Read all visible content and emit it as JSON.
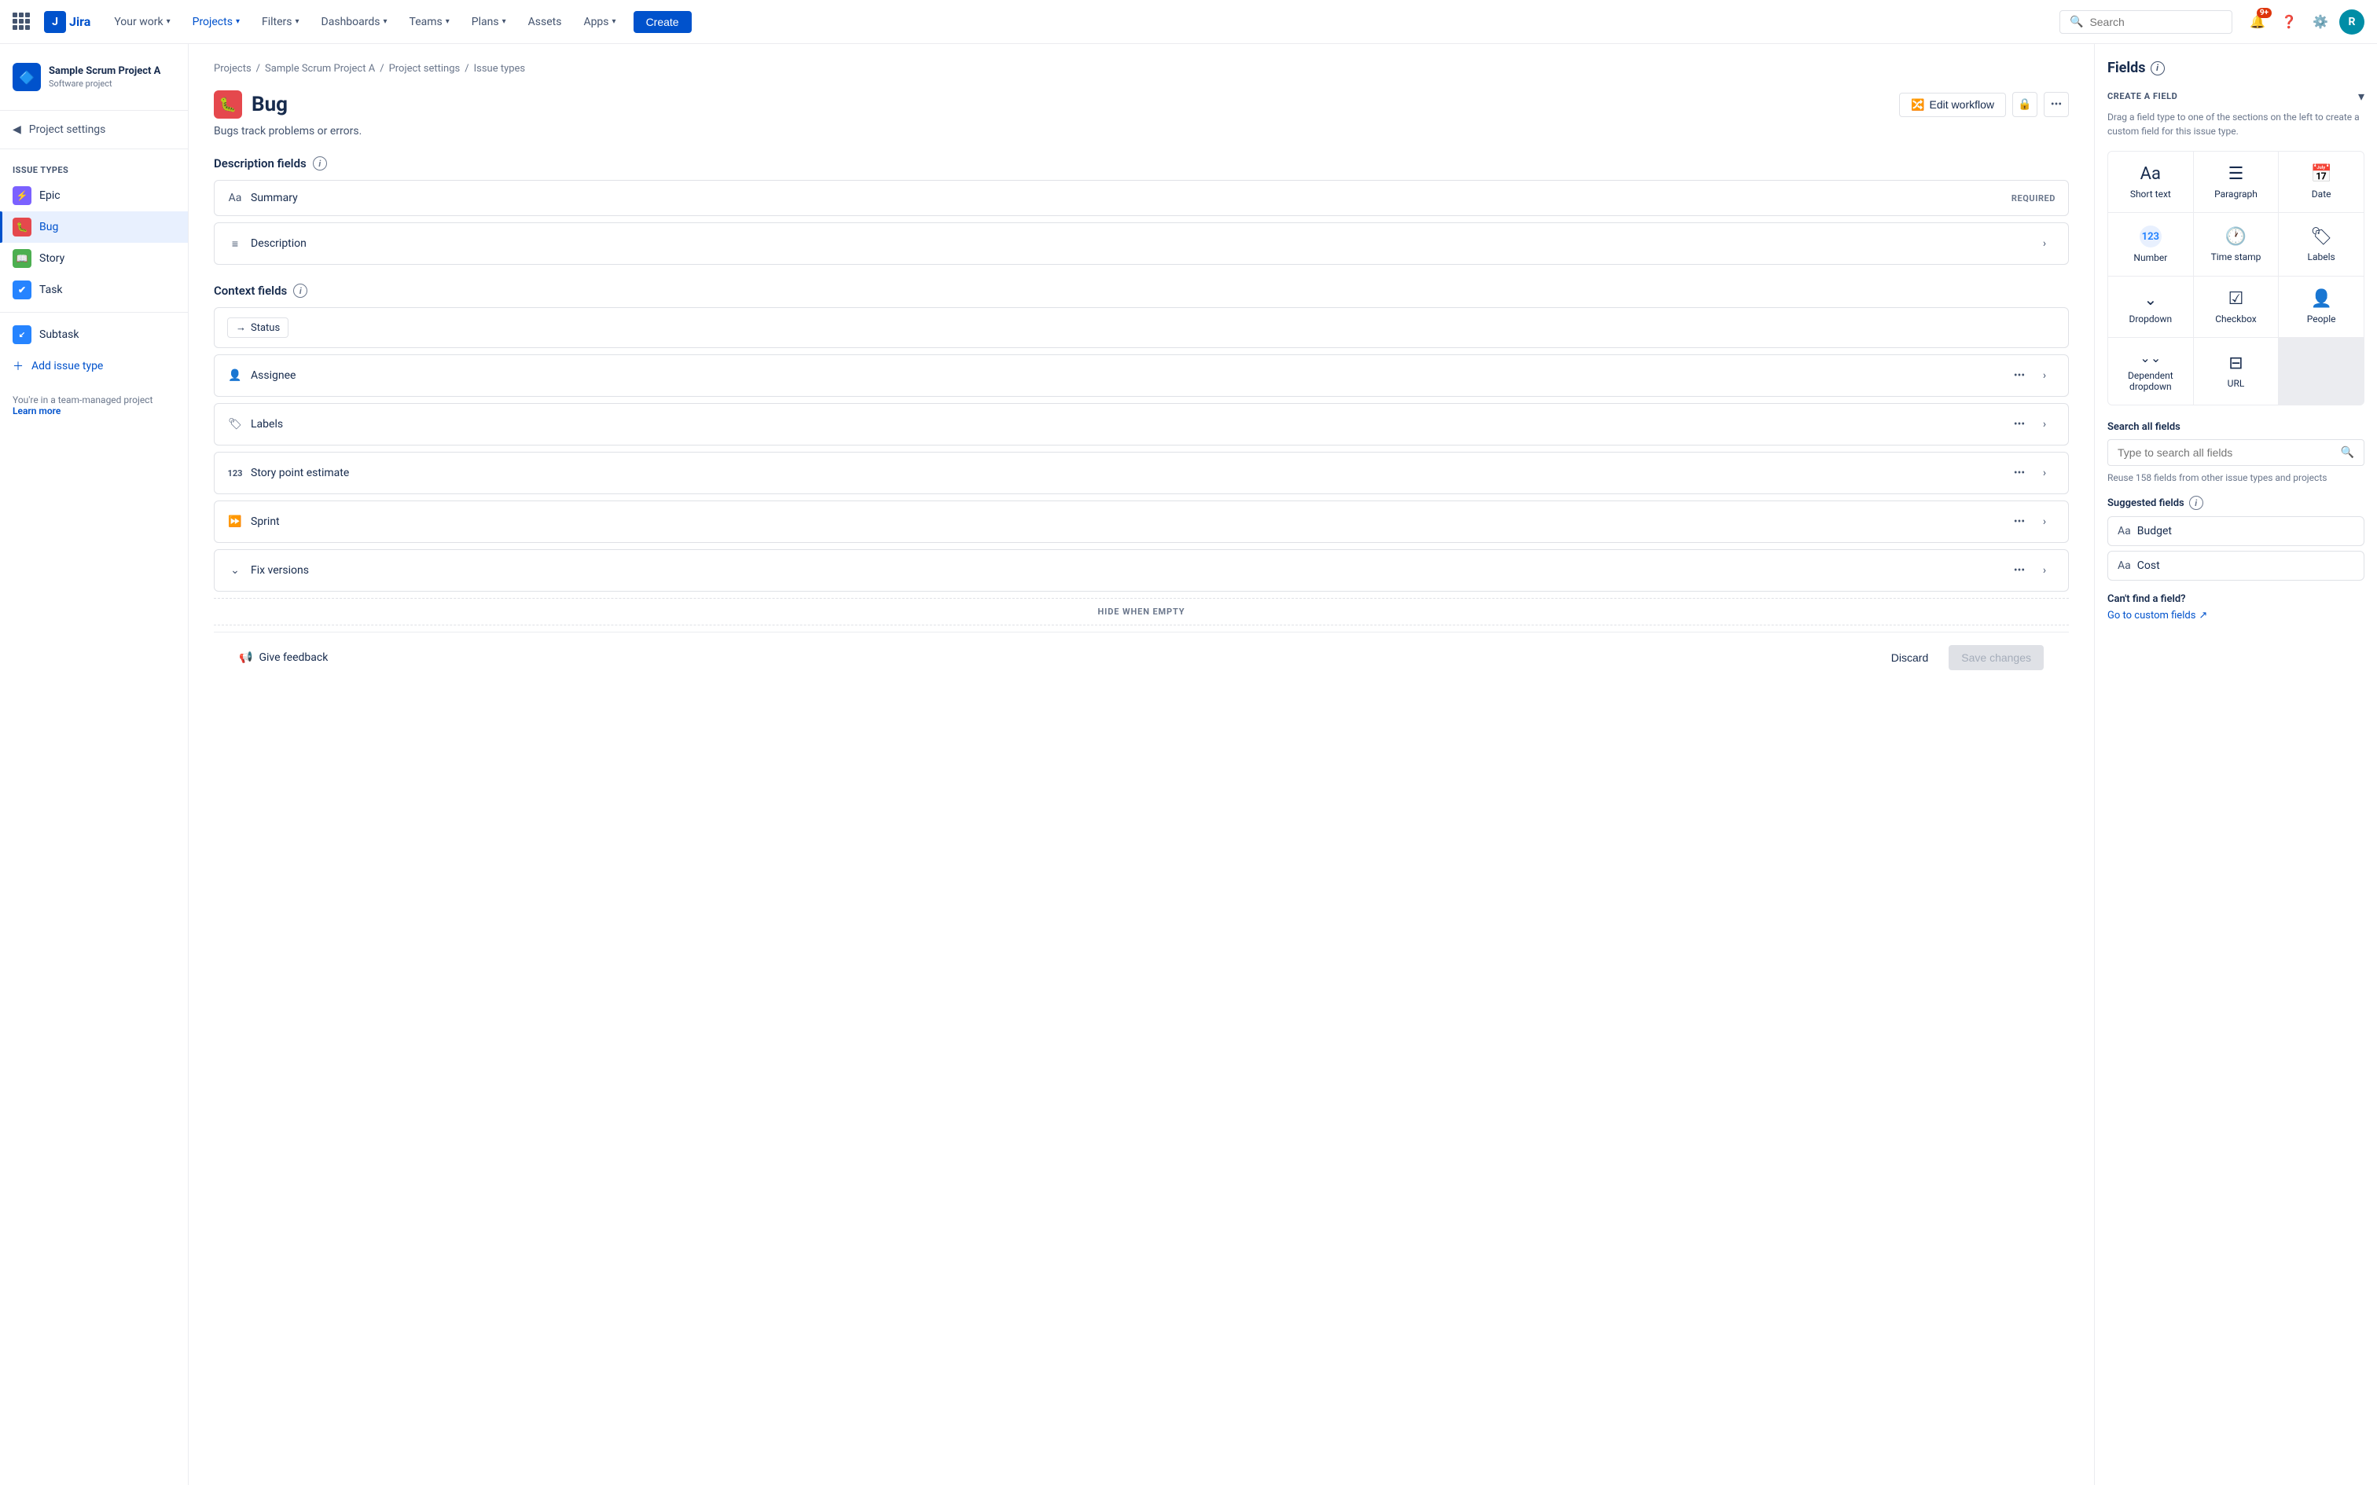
{
  "topnav": {
    "logo_text": "Jira",
    "your_work": "Your work",
    "projects": "Projects",
    "filters": "Filters",
    "dashboards": "Dashboards",
    "teams": "Teams",
    "plans": "Plans",
    "assets": "Assets",
    "apps": "Apps",
    "create_label": "Create",
    "search_placeholder": "Search",
    "notification_count": "9+",
    "avatar_initials": "R"
  },
  "sidebar": {
    "project_name": "Sample Scrum Project A",
    "project_type": "Software project",
    "project_settings_label": "Project settings",
    "issue_types_title": "Issue types",
    "issue_types": [
      {
        "name": "Epic",
        "type": "epic"
      },
      {
        "name": "Bug",
        "type": "bug",
        "active": true
      },
      {
        "name": "Story",
        "type": "story"
      },
      {
        "name": "Task",
        "type": "task"
      }
    ],
    "subtask_label": "Subtask",
    "add_issue_type_label": "Add issue type",
    "footer_text": "You're in a team-managed project",
    "learn_more_label": "Learn more"
  },
  "breadcrumb": {
    "items": [
      "Projects",
      "Sample Scrum Project A",
      "Project settings",
      "Issue types"
    ]
  },
  "main": {
    "page_title": "Bug",
    "page_desc": "Bugs track problems or errors.",
    "edit_workflow_label": "Edit workflow",
    "description_fields_title": "Description fields",
    "context_fields_title": "Context fields",
    "hide_when_empty_label": "HIDE WHEN EMPTY",
    "fields": {
      "description": [
        {
          "name": "Summary",
          "required": true,
          "icon": "Aa"
        },
        {
          "name": "Description",
          "required": false,
          "icon": "≡"
        }
      ],
      "context": [
        {
          "name": "Status",
          "type": "status"
        },
        {
          "name": "Assignee",
          "type": "field"
        },
        {
          "name": "Labels",
          "type": "field"
        },
        {
          "name": "Story point estimate",
          "type": "field"
        },
        {
          "name": "Sprint",
          "type": "field"
        },
        {
          "name": "Fix versions",
          "type": "field"
        }
      ]
    }
  },
  "bottom_bar": {
    "feedback_label": "Give feedback",
    "discard_label": "Discard",
    "save_label": "Save changes"
  },
  "right_panel": {
    "title": "Fields",
    "create_field_title": "CREATE A FIELD",
    "create_field_desc": "Drag a field type to one of the sections on the left to create a custom field for this issue type.",
    "field_types": [
      {
        "label": "Short text",
        "icon": "Aa"
      },
      {
        "label": "Paragraph",
        "icon": "☰"
      },
      {
        "label": "Date",
        "icon": "📅"
      },
      {
        "label": "Number",
        "icon": "123"
      },
      {
        "label": "Time stamp",
        "icon": "🕐"
      },
      {
        "label": "Labels",
        "icon": "🏷"
      },
      {
        "label": "Dropdown",
        "icon": "⌄"
      },
      {
        "label": "Checkbox",
        "icon": "☑"
      },
      {
        "label": "People",
        "icon": "👤"
      },
      {
        "label": "Dependent dropdown",
        "icon": "⌄⌄"
      },
      {
        "label": "URL",
        "icon": "⊟"
      }
    ],
    "search_all_title": "Search all fields",
    "search_placeholder": "Type to search all fields",
    "reuse_text": "Reuse 158 fields from other issue types and projects",
    "suggested_title": "Suggested fields",
    "suggested_fields": [
      {
        "name": "Budget",
        "icon": "Aa"
      },
      {
        "name": "Cost",
        "icon": "Aa"
      }
    ],
    "cant_find_text": "Can't find a field?",
    "custom_fields_link": "Go to custom fields"
  }
}
